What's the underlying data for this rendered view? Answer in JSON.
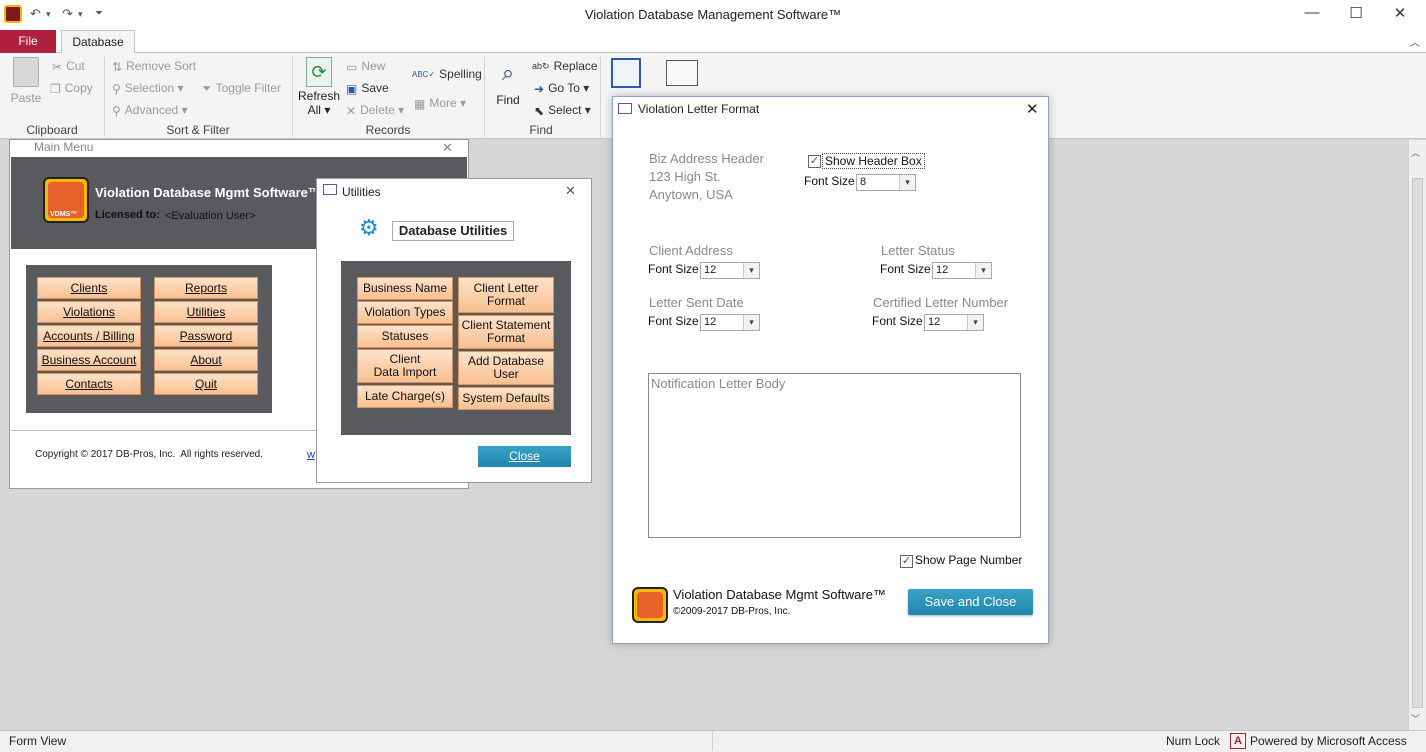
{
  "app": {
    "title": "Violation Database Management Software™"
  },
  "ribbon": {
    "tabs": {
      "file": "File",
      "database": "Database"
    },
    "clipboard": {
      "paste": "Paste",
      "cut": "Cut",
      "copy": "Copy",
      "label": "Clipboard"
    },
    "sortfilter": {
      "remove_sort": "Remove Sort",
      "selection": "Selection",
      "advanced": "Advanced",
      "toggle_filter": "Toggle Filter",
      "label": "Sort & Filter"
    },
    "records": {
      "refresh": "Refresh",
      "refresh_all": "All",
      "new": "New",
      "save": "Save",
      "delete": "Delete",
      "spelling": "Spelling",
      "more": "More",
      "label": "Records"
    },
    "find": {
      "find": "Find",
      "replace": "Replace",
      "goto": "Go To",
      "select": "Select",
      "label": "Find"
    }
  },
  "mainmenu": {
    "title": "Main Menu",
    "app_name": "Violation Database Mgmt Software™",
    "licensed_label": "Licensed to:",
    "licensed_value": "<Evaluation User>",
    "logo_tag": "VDMS™",
    "buttons_left": [
      "Clients",
      "Violations",
      "Accounts / Billing",
      "Business Account",
      "Contacts"
    ],
    "buttons_right": [
      "Reports",
      "Utilities",
      "Password",
      "About",
      "Quit"
    ],
    "copyright": "Copyright © 2017 DB-Pros, Inc.  All rights reserved.",
    "link_fragment": "w"
  },
  "utilities": {
    "title": "Utilities",
    "heading": "Database Utilities",
    "buttons_left": [
      "Business Name",
      "Violation Types",
      "Statuses",
      "Client\nData Import",
      "Late Charge(s)"
    ],
    "buttons_right": [
      "Client Letter\nFormat",
      "Client Statement\nFormat",
      "Add Database\nUser",
      "System Defaults"
    ],
    "close": "Close"
  },
  "vlf": {
    "title": "Violation Letter Format",
    "biz_header_lines": [
      "Biz Address Header",
      "123 High St.",
      "Anytown, USA"
    ],
    "show_header_box": "Show Header Box",
    "show_header_checked": true,
    "font_size_label": "Font Size",
    "header_font": "8",
    "client_address": "Client Address",
    "client_address_font": "12",
    "letter_status": "Letter Status",
    "letter_status_font": "12",
    "letter_sent_date": "Letter Sent Date",
    "letter_sent_font": "12",
    "certified_number": "Certified Letter Number",
    "certified_font": "12",
    "body_placeholder": "Notification Letter Body",
    "show_page_number": "Show Page Number",
    "show_page_checked": true,
    "footer_app": "Violation Database Mgmt Software™",
    "footer_copy": "©2009-2017 DB-Pros, Inc.",
    "save_close": "Save and Close"
  },
  "statusbar": {
    "left": "Form View",
    "numlock": "Num Lock",
    "powered": "Powered by Microsoft Access"
  },
  "colors": {
    "file_tab": "#b1203c",
    "menu_button": "#f9c091",
    "panel": "#595a5e",
    "accent_blue": "#1f86ad"
  }
}
